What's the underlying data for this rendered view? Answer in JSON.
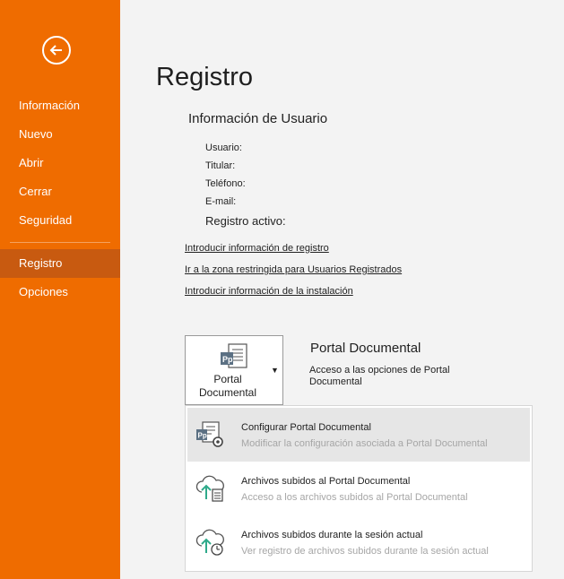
{
  "sidebar": {
    "items": [
      {
        "label": "Información"
      },
      {
        "label": "Nuevo"
      },
      {
        "label": "Abrir"
      },
      {
        "label": "Cerrar"
      },
      {
        "label": "Seguridad"
      },
      {
        "label": "Registro"
      },
      {
        "label": "Opciones"
      }
    ],
    "active": "Registro",
    "accent": "#ef6c00",
    "active_bg": "#c85a10"
  },
  "main": {
    "title": "Registro",
    "section_title": "Información de Usuario",
    "fields": [
      {
        "label": "Usuario:"
      },
      {
        "label": "Titular:"
      },
      {
        "label": "Teléfono:"
      },
      {
        "label": "E-mail:"
      }
    ],
    "registro_activo": "Registro activo:",
    "links": [
      {
        "label": "Introducir información de registro"
      },
      {
        "label": "Ir a la zona restringida para Usuarios Registrados"
      },
      {
        "label": "Introducir información de la instalación"
      }
    ],
    "portal": {
      "button_label_1": "Portal",
      "button_label_2": "Documental",
      "title": "Portal Documental",
      "description": "Acceso a las opciones de Portal Documental",
      "icon": "portal-documental-icon"
    },
    "dropdown": {
      "items": [
        {
          "title": "Configurar Portal Documental",
          "subtitle": "Modificar la configuración asociada a Portal Documental",
          "icon": "configure-portal-icon"
        },
        {
          "title": "Archivos subidos al Portal Documental",
          "subtitle": "Acceso a los archivos subidos al Portal Documental",
          "icon": "cloud-upload-document-icon"
        },
        {
          "title": "Archivos subidos durante la sesión actual",
          "subtitle": "Ver registro de archivos subidos durante la sesión actual",
          "icon": "cloud-upload-clock-icon"
        }
      ]
    }
  }
}
